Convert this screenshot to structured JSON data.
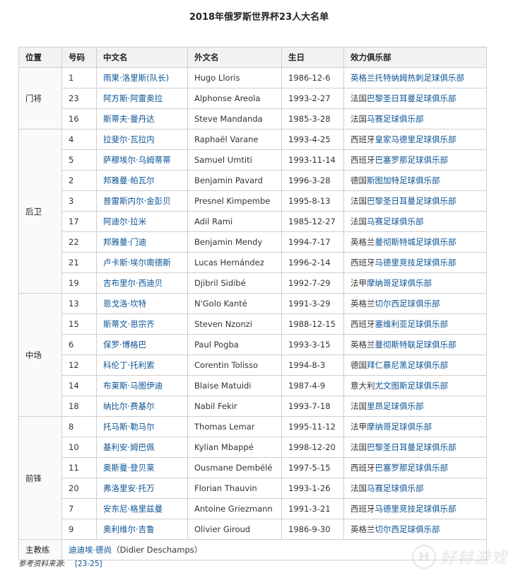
{
  "title": "2018年俄罗斯世界杯23人大名单",
  "headers": [
    "位置",
    "号码",
    "中文名",
    "外文名",
    "生日",
    "效力俱乐部"
  ],
  "groups": [
    {
      "position": "门将",
      "players": [
        {
          "number": "1",
          "cn": "雨果·洛里斯(队长)",
          "en": "Hugo Lloris",
          "birth": "1986-12-6",
          "club_prefix": "",
          "club": "英格兰托特纳姆热刺足球俱乐部"
        },
        {
          "number": "23",
          "cn": "阿方斯·阿雷奥拉",
          "en": "Alphonse Areola",
          "birth": "1993-2-27",
          "club_prefix": "法国",
          "club": "巴黎圣日耳曼足球俱乐部"
        },
        {
          "number": "16",
          "cn": "斯蒂夫·曼丹达",
          "en": "Steve Mandanda",
          "birth": "1985-3-28",
          "club_prefix": "法国",
          "club": "马赛足球俱乐部"
        }
      ]
    },
    {
      "position": "后卫",
      "players": [
        {
          "number": "4",
          "cn": "拉斐尔·瓦拉内",
          "en": "Raphaël Varane",
          "birth": "1993-4-25",
          "club_prefix": "西班牙",
          "club": "皇家马德里足球俱乐部"
        },
        {
          "number": "5",
          "cn": "萨穆埃尔·乌姆蒂蒂",
          "en": "Samuel Umtiti",
          "birth": "1993-11-14",
          "club_prefix": "西班牙",
          "club": "巴塞罗那足球俱乐部"
        },
        {
          "number": "2",
          "cn": "邦雅曼·帕瓦尔",
          "en": "Benjamin Pavard",
          "birth": "1996-3-28",
          "club_prefix": "德国",
          "club": "斯图加特足球俱乐部"
        },
        {
          "number": "3",
          "cn": "普雷斯内尔·金彭贝",
          "en": "Presnel Kimpembe",
          "birth": "1995-8-13",
          "club_prefix": "法国",
          "club": "巴黎圣日耳曼足球俱乐部"
        },
        {
          "number": "17",
          "cn": "阿迪尔·拉米",
          "en": "Adil Rami",
          "birth": "1985-12-27",
          "club_prefix": "法国",
          "club": "马赛足球俱乐部"
        },
        {
          "number": "22",
          "cn": "邦雅曼·门迪",
          "en": "Benjamin Mendy",
          "birth": "1994-7-17",
          "club_prefix": "英格兰",
          "club": "曼彻斯特城足球俱乐部"
        },
        {
          "number": "21",
          "cn": "卢卡斯·埃尔南德斯",
          "en": "Lucas Hernández",
          "birth": "1996-2-14",
          "club_prefix": "西班牙",
          "club": "马德里竞技足球俱乐部"
        },
        {
          "number": "19",
          "cn": "吉布里尔·西迪贝",
          "en": "Djibril Sidibé",
          "birth": "1992-7-29",
          "club_prefix": "法甲",
          "club": "摩纳哥足球俱乐部"
        }
      ]
    },
    {
      "position": "中场",
      "players": [
        {
          "number": "13",
          "cn": "恩戈洛·坎特",
          "en": "N'Golo Kanté",
          "birth": "1991-3-29",
          "club_prefix": "英格兰",
          "club": "切尔西足球俱乐部"
        },
        {
          "number": "15",
          "cn": "斯蒂文·恩宗齐",
          "en": "Steven Nzonzi",
          "birth": "1988-12-15",
          "club_prefix": "西班牙",
          "club": "塞维利亚足球俱乐部"
        },
        {
          "number": "6",
          "cn": "保罗·博格巴",
          "en": "Paul Pogba",
          "birth": "1993-3-15",
          "club_prefix": "英格兰",
          "club": "曼彻斯特联足球俱乐部"
        },
        {
          "number": "12",
          "cn": "科伦丁·托利索",
          "en": "Corentin Tolisso",
          "birth": "1994-8-3",
          "club_prefix": "德国",
          "club": "拜仁慕尼黑足球俱乐部"
        },
        {
          "number": "14",
          "cn": "布莱斯·马图伊迪",
          "en": "Blaise Matuidi",
          "birth": "1987-4-9",
          "club_prefix": "意大利",
          "club": "尤文图斯足球俱乐部"
        },
        {
          "number": "18",
          "cn": "纳比尔·费基尔",
          "en": "Nabil Fekir",
          "birth": "1993-7-18",
          "club_prefix": "法国",
          "club": "里昂足球俱乐部"
        }
      ]
    },
    {
      "position": "前锋",
      "players": [
        {
          "number": "8",
          "cn": "托马斯·勒马尔",
          "en": "Thomas Lemar",
          "birth": "1995-11-12",
          "club_prefix": "法甲",
          "club": "摩纳哥足球俱乐部"
        },
        {
          "number": "10",
          "cn": "基利安·姆巴佩",
          "en": "Kylian Mbappé",
          "birth": "1998-12-20",
          "club_prefix": "法国",
          "club": "巴黎圣日耳曼足球俱乐部"
        },
        {
          "number": "11",
          "cn": "奥斯曼·登贝莱",
          "en": "Ousmane Dembélé",
          "birth": "1997-5-15",
          "club_prefix": "西班牙",
          "club": "巴塞罗那足球俱乐部"
        },
        {
          "number": "20",
          "cn": "弗洛里安·托万",
          "en": "Florian Thauvin",
          "birth": "1993-1-26",
          "club_prefix": "法国",
          "club": "马赛足球俱乐部"
        },
        {
          "number": "7",
          "cn": "安东尼·格里兹曼",
          "en": "Antoine Griezmann",
          "birth": "1991-3-21",
          "club_prefix": "西班牙",
          "club": "马德里竞技足球俱乐部"
        },
        {
          "number": "9",
          "cn": "奥利维尔·吉鲁",
          "en": "Olivier Giroud",
          "birth": "1986-9-30",
          "club_prefix": "英格兰",
          "club": "切尔西足球俱乐部"
        }
      ]
    }
  ],
  "coach": {
    "label": "主教练",
    "name": "迪迪埃·德尚",
    "name_en": "（Didier Deschamps）"
  },
  "footer": {
    "label": "参考资料来源:",
    "ref": "[23-25]"
  },
  "watermark": {
    "logo": "H",
    "text": "好特游戏"
  }
}
